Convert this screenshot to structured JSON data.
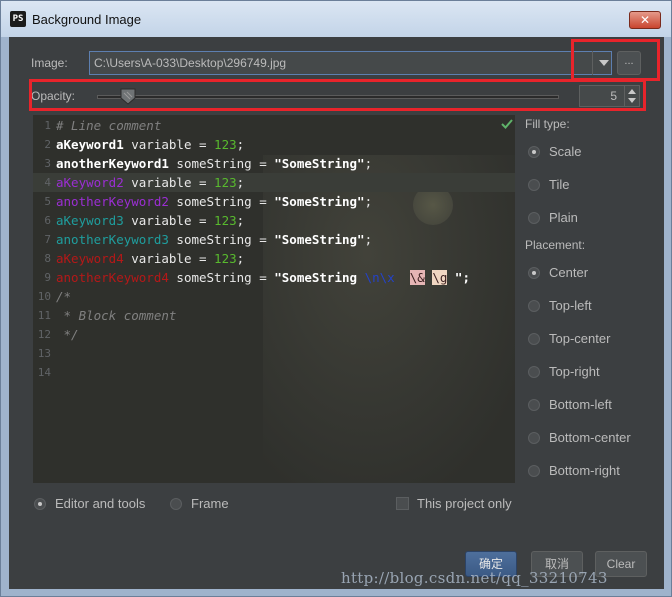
{
  "window": {
    "app_icon_text": "PS",
    "title": "Background Image",
    "close_glyph": "✕"
  },
  "image": {
    "label": "Image:",
    "path": "C:\\Users\\A-033\\Desktop\\296749.jpg",
    "browse_label": "..."
  },
  "opacity": {
    "label": "Opacity:",
    "value": "5",
    "slider_fraction": 0.05
  },
  "editor": {
    "line_numbers": [
      "1",
      "2",
      "3",
      "4",
      "5",
      "6",
      "7",
      "8",
      "9",
      "10",
      "11",
      "12",
      "13",
      "14"
    ],
    "lines": [
      [
        {
          "t": "# Line comment",
          "c": "c-com"
        }
      ],
      [
        {
          "t": "aKeyword1",
          "c": "c-bold"
        },
        {
          "t": " variable = ",
          "c": "c-plain"
        },
        {
          "t": "123",
          "c": "c-num"
        },
        {
          "t": ";",
          "c": "c-plain"
        }
      ],
      [
        {
          "t": "anotherKeyword1",
          "c": "c-bold"
        },
        {
          "t": " someString = ",
          "c": "c-plain"
        },
        {
          "t": "\"SomeString\"",
          "c": "c-str"
        },
        {
          "t": ";",
          "c": "c-plain"
        }
      ],
      [
        {
          "t": "aKeyword2",
          "c": "c-purple"
        },
        {
          "t": " variable = ",
          "c": "c-plain"
        },
        {
          "t": "123",
          "c": "c-num"
        },
        {
          "t": ";",
          "c": "c-plain"
        }
      ],
      [
        {
          "t": "anotherKeyword2",
          "c": "c-purple"
        },
        {
          "t": " someString = ",
          "c": "c-plain"
        },
        {
          "t": "\"SomeString\"",
          "c": "c-str"
        },
        {
          "t": ";",
          "c": "c-plain"
        }
      ],
      [
        {
          "t": "aKeyword3",
          "c": "c-teal"
        },
        {
          "t": " variable = ",
          "c": "c-plain"
        },
        {
          "t": "123",
          "c": "c-num"
        },
        {
          "t": ";",
          "c": "c-plain"
        }
      ],
      [
        {
          "t": "anotherKeyword3",
          "c": "c-teal"
        },
        {
          "t": " someString = ",
          "c": "c-plain"
        },
        {
          "t": "\"SomeString\"",
          "c": "c-str"
        },
        {
          "t": ";",
          "c": "c-plain"
        }
      ],
      [
        {
          "t": "aKeyword4",
          "c": "c-red"
        },
        {
          "t": " variable = ",
          "c": "c-plain"
        },
        {
          "t": "123",
          "c": "c-num"
        },
        {
          "t": ";",
          "c": "c-plain"
        }
      ],
      [
        {
          "t": "anotherKeyword4",
          "c": "c-red"
        },
        {
          "t": " someString = ",
          "c": "c-plain"
        },
        {
          "t": "\"SomeString ",
          "c": "c-str"
        },
        {
          "t": "\\n\\x",
          "c": "c-blue"
        },
        {
          "t": "  ",
          "c": "c-plain"
        },
        {
          "t": "\\&",
          "c": "c-esc"
        },
        {
          "t": " ",
          "c": "c-plain"
        },
        {
          "t": "\\g",
          "c": "c-esc2"
        },
        {
          "t": " \";",
          "c": "c-str"
        }
      ],
      [
        {
          "t": "/*",
          "c": "c-com"
        }
      ],
      [
        {
          "t": " * Block comment",
          "c": "c-com"
        }
      ],
      [
        {
          "t": " */",
          "c": "c-com"
        }
      ],
      [],
      []
    ]
  },
  "fill_type": {
    "label": "Fill type:",
    "options": [
      "Scale",
      "Tile",
      "Plain"
    ],
    "selected": 0
  },
  "placement": {
    "label": "Placement:",
    "options": [
      "Center",
      "Top-left",
      "Top-center",
      "Top-right",
      "Bottom-left",
      "Bottom-center",
      "Bottom-right"
    ],
    "selected": 0
  },
  "target": {
    "editor_label": "Editor and tools",
    "frame_label": "Frame",
    "project_label": "This project only"
  },
  "buttons": {
    "ok": "确定",
    "cancel": "取消",
    "clear": "Clear"
  },
  "watermark": "http://blog.csdn.net/qq_33210743",
  "colors": {
    "highlight_box": "#e8242b",
    "ok_button": "#4a6b98",
    "editor_bg": "#2f302c"
  }
}
